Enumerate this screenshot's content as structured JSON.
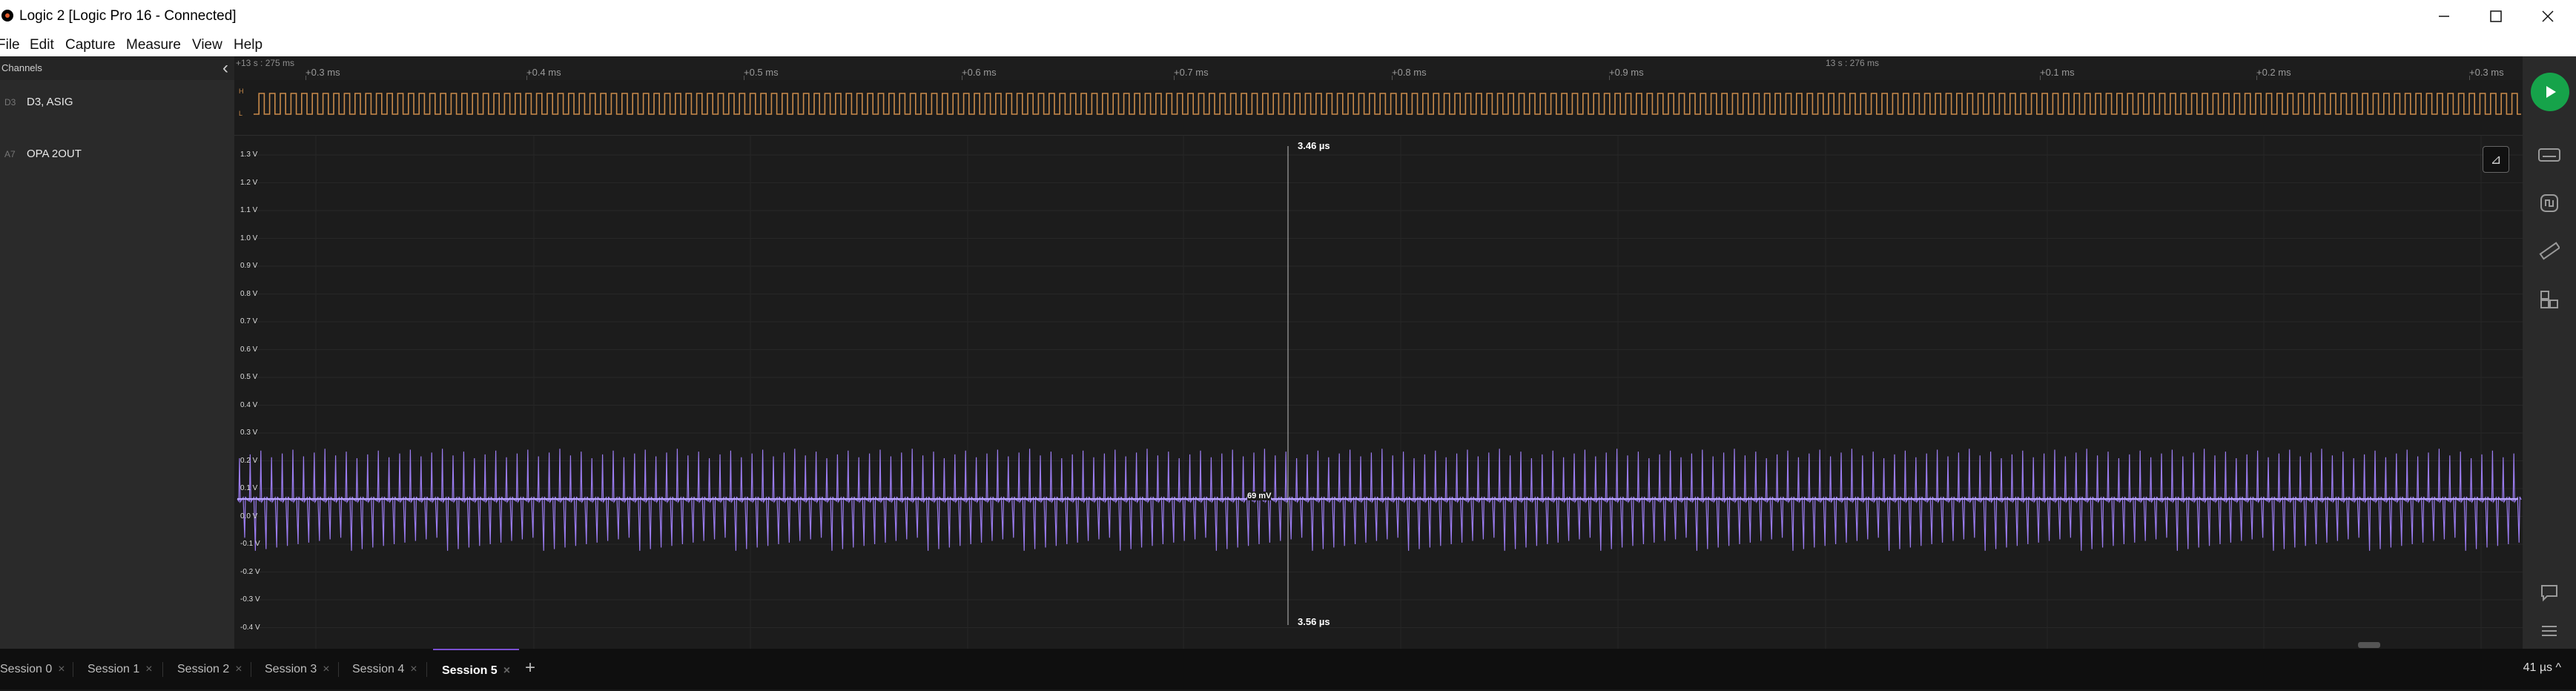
{
  "window": {
    "title": "Logic 2 [Logic Pro 16 - Connected]"
  },
  "menu": [
    "File",
    "Edit",
    "Capture",
    "Measure",
    "View",
    "Help"
  ],
  "sidebar": {
    "header": "Channels",
    "channels": [
      {
        "index": "D3",
        "name": "D3, ASIG"
      },
      {
        "index": "A7",
        "name": "OPA 2OUT"
      }
    ]
  },
  "ruler": {
    "anchors": [
      {
        "label": "+13 s : 275 ms"
      },
      {
        "label": "13 s : 276 ms"
      }
    ],
    "ticks": [
      "+0.3 ms",
      "+0.4 ms",
      "+0.5 ms",
      "+0.6 ms",
      "+0.7 ms",
      "+0.8 ms",
      "+0.9 ms",
      "+0.1 ms",
      "+0.2 ms",
      "+0.3 ms"
    ]
  },
  "digital_levels": {
    "high": "H",
    "low": "L"
  },
  "analog_axis": [
    "1.3 V",
    "1.2 V",
    "1.1 V",
    "1.0 V",
    "0.9 V",
    "0.8 V",
    "0.7 V",
    "0.6 V",
    "0.5 V",
    "0.4 V",
    "0.3 V",
    "0.2 V",
    "0.1 V",
    "0.0 V",
    "-0.1 V",
    "-0.2 V",
    "-0.3 V",
    "-0.4 V"
  ],
  "measurements": {
    "top_marker": "3.46 µs",
    "bottom_marker": "3.56 µs",
    "value_label": "69 mV"
  },
  "colors": {
    "digital": "#c98a4a",
    "analog": "#9b7cf0",
    "play": "#16a34a",
    "active_tab": "#7a4fd0"
  },
  "icons": {
    "play": "play-icon",
    "keyboard": "keyboard-icon",
    "trigger": "timing-icon",
    "measure": "ruler-icon",
    "extensions": "extensions-icon",
    "notes": "comment-icon",
    "menu": "hamburger-icon"
  },
  "tabs": [
    {
      "label": "Session 0"
    },
    {
      "label": "Session 1"
    },
    {
      "label": "Session 2"
    },
    {
      "label": "Session 3"
    },
    {
      "label": "Session 4"
    },
    {
      "label": "Session 5",
      "active": true
    }
  ],
  "zoom": "41 µs ^"
}
